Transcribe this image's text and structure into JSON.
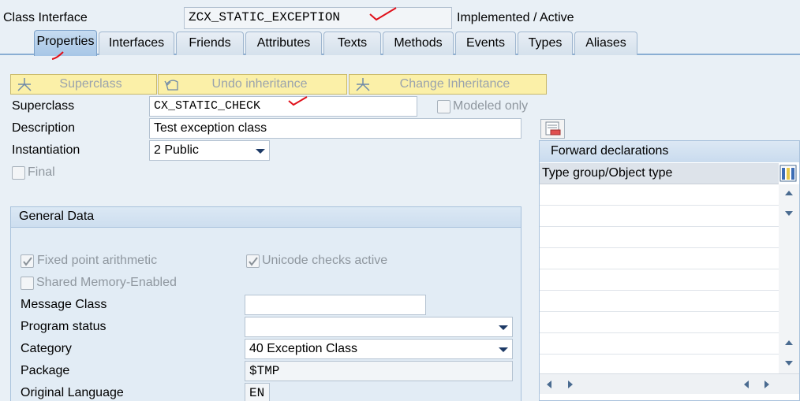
{
  "header": {
    "class_interface_label": "Class Interface",
    "class_name": "ZCX_STATIC_EXCEPTION",
    "status": "Implemented / Active"
  },
  "tabs": [
    {
      "label": "Properties",
      "active": true
    },
    {
      "label": "Interfaces"
    },
    {
      "label": "Friends"
    },
    {
      "label": "Attributes"
    },
    {
      "label": "Texts"
    },
    {
      "label": "Methods"
    },
    {
      "label": "Events"
    },
    {
      "label": "Types"
    },
    {
      "label": "Aliases"
    }
  ],
  "toolbar": {
    "superclass_btn": "Superclass",
    "undo_inheritance_btn": "Undo inheritance",
    "change_inheritance_btn": "Change Inheritance"
  },
  "props": {
    "superclass_label": "Superclass",
    "superclass_value": "CX_STATIC_CHECK",
    "modeled_only_label": "Modeled only",
    "description_label": "Description",
    "description_value": "Test exception class",
    "instantiation_label": "Instantiation",
    "instantiation_value": "2 Public",
    "final_label": "Final"
  },
  "general": {
    "title": "General Data",
    "fixed_point_label": "Fixed point arithmetic",
    "fixed_point_checked": true,
    "unicode_label": "Unicode checks active",
    "unicode_checked": true,
    "shared_memory_label": "Shared Memory-Enabled",
    "message_class_label": "Message Class",
    "message_class_value": "",
    "program_status_label": "Program status",
    "program_status_value": "",
    "category_label": "Category",
    "category_value": "40 Exception Class",
    "package_label": "Package",
    "package_value": "$TMP",
    "orig_lang_label": "Original Language",
    "orig_lang_value": "EN"
  },
  "forward": {
    "title": "Forward declarations",
    "column": "Type group/Object type"
  },
  "colors": {
    "tab_active": "#a7c6e6",
    "button_bg": "#fbf0a8",
    "annotation_red": "#e0101a"
  }
}
